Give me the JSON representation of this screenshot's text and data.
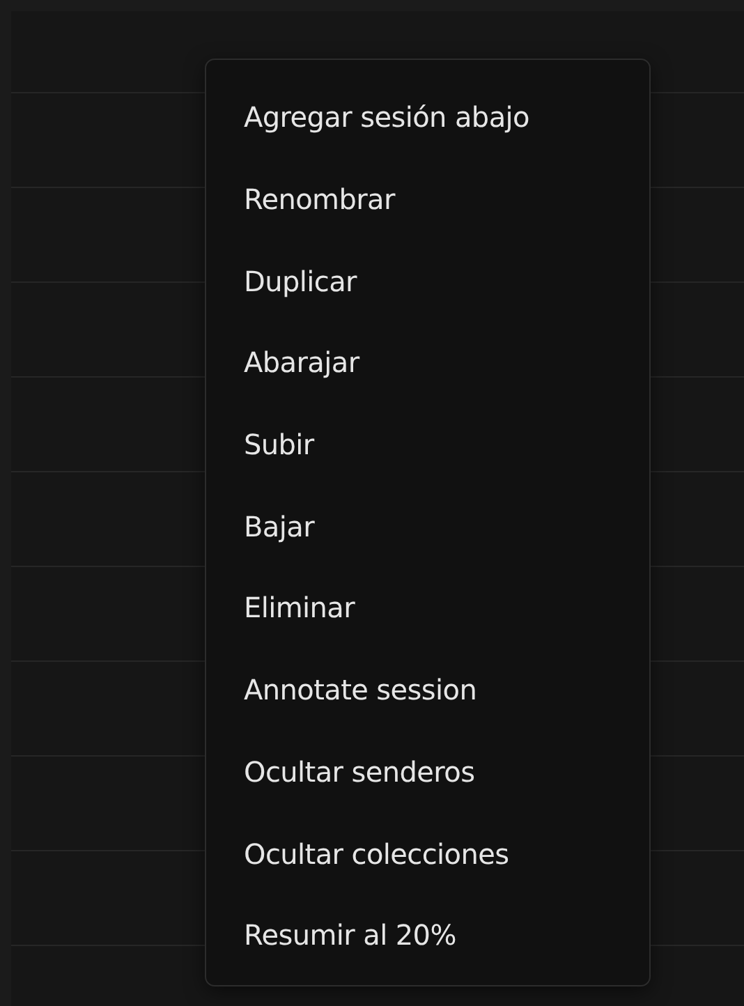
{
  "context_menu": {
    "items": [
      {
        "label": "Agregar sesión abajo"
      },
      {
        "label": "Renombrar"
      },
      {
        "label": "Duplicar"
      },
      {
        "label": "Abarajar"
      },
      {
        "label": "Subir"
      },
      {
        "label": "Bajar"
      },
      {
        "label": "Eliminar"
      },
      {
        "label": "Annotate session"
      },
      {
        "label": "Ocultar senderos"
      },
      {
        "label": "Ocultar colecciones"
      },
      {
        "label": "Resumir al 20%"
      }
    ]
  }
}
